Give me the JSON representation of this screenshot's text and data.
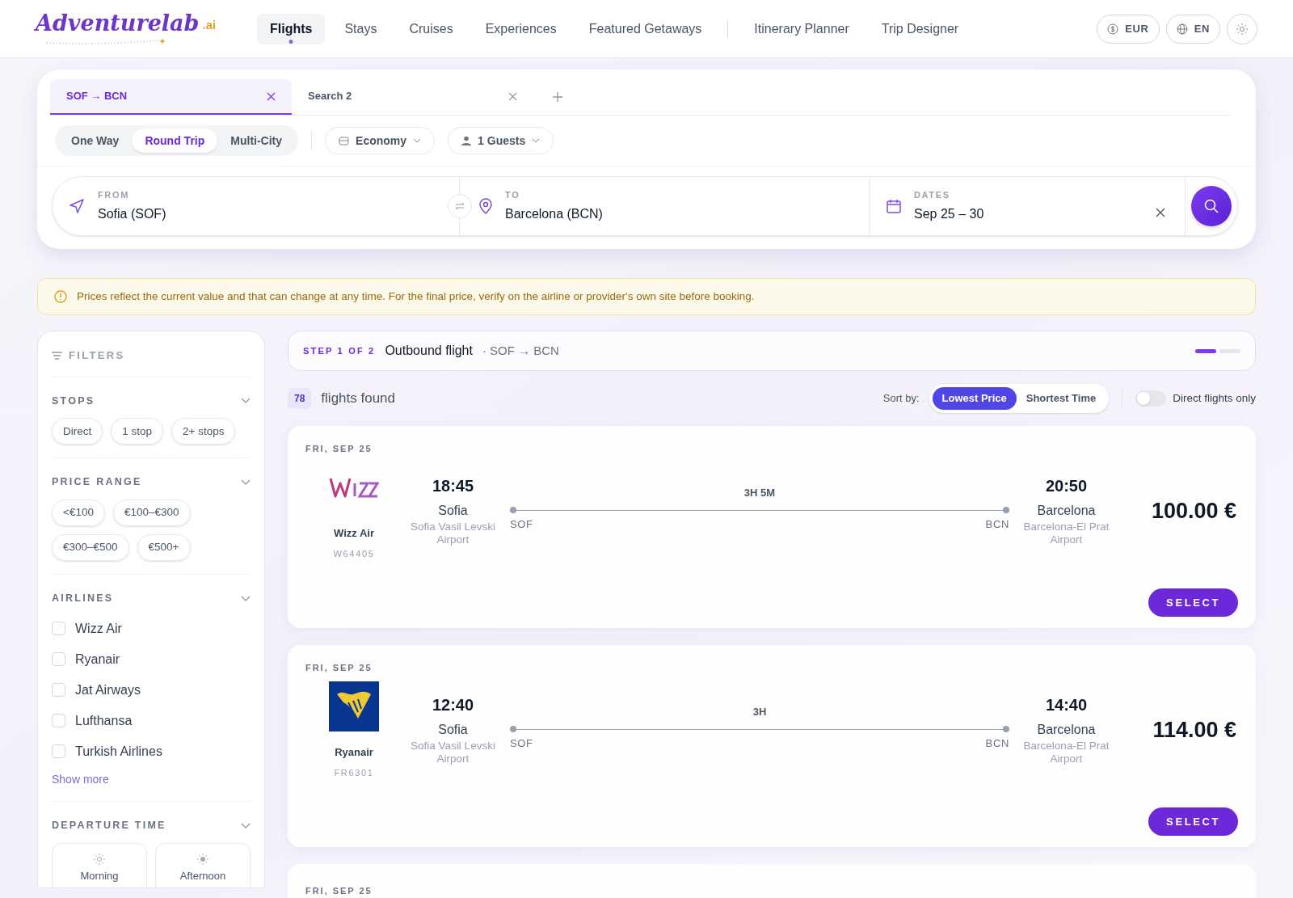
{
  "logo": {
    "name": "Adventurelab",
    "suffix": ".ai"
  },
  "nav_primary": [
    {
      "label": "Flights",
      "selected": true
    },
    {
      "label": "Stays",
      "selected": false
    },
    {
      "label": "Cruises",
      "selected": false
    },
    {
      "label": "Experiences",
      "selected": false
    },
    {
      "label": "Featured Getaways",
      "selected": false
    }
  ],
  "nav_secondary": [
    {
      "label": "Itinerary Planner",
      "selected": false
    },
    {
      "label": "Trip Designer",
      "selected": false
    }
  ],
  "header_controls": {
    "currency": "EUR",
    "language": "EN"
  },
  "search_tabs": [
    {
      "label": "SOF → BCN",
      "selected": true
    },
    {
      "label": "Search 2",
      "selected": false
    }
  ],
  "trip_types": [
    {
      "label": "One Way",
      "selected": false
    },
    {
      "label": "Round Trip",
      "selected": true
    },
    {
      "label": "Multi-City",
      "selected": false
    }
  ],
  "cabin": "Economy",
  "guests": "1 Guests",
  "fields": {
    "from": {
      "label": "FROM",
      "value": "Sofia (SOF)"
    },
    "to": {
      "label": "TO",
      "value": "Barcelona (BCN)"
    },
    "dates": {
      "label": "DATES",
      "value": "Sep 25 – 30"
    }
  },
  "notice": "Prices reflect the current value and that can change at any time. For the final price, verify on the airline or provider's own site before booking.",
  "filters": {
    "title": "FILTERS",
    "sections": [
      {
        "kind": "chips",
        "title": "STOPS",
        "options": [
          "Direct",
          "1 stop",
          "2+ stops"
        ]
      },
      {
        "kind": "chips",
        "title": "PRICE RANGE",
        "options": [
          "<€100",
          "€100–€300",
          "€300–€500",
          "€500+"
        ]
      },
      {
        "kind": "checkboxes",
        "title": "AIRLINES",
        "options": [
          {
            "label": "Wizz Air",
            "checked": false
          },
          {
            "label": "Ryanair",
            "checked": false
          },
          {
            "label": "Jat Airways",
            "checked": false
          },
          {
            "label": "Lufthansa",
            "checked": false
          },
          {
            "label": "Turkish Airlines",
            "checked": false
          }
        ],
        "more": "Show more"
      },
      {
        "kind": "tiles",
        "title": "DEPARTURE TIME",
        "options": [
          "Morning",
          "Afternoon"
        ]
      }
    ]
  },
  "step": {
    "label": "STEP 1 OF 2",
    "title": "Outbound flight",
    "route": "· SOF → BCN",
    "progress": [
      {
        "selected": true
      },
      {
        "selected": false
      }
    ]
  },
  "results": {
    "count": "78",
    "label": "flights found"
  },
  "sort": {
    "label": "Sort by:",
    "options": [
      {
        "label": "Lowest Price",
        "selected": true
      },
      {
        "label": "Shortest Time",
        "selected": false
      }
    ]
  },
  "direct_toggle": {
    "label": "Direct flights only",
    "on": false
  },
  "flights": [
    {
      "date": "FRI, SEP 25",
      "kind": "wizz",
      "airline": "Wizz Air",
      "number": "W64405",
      "depart": "18:45",
      "from_city": "Sofia",
      "from_airport": "Sofia Vasil Levski Airport",
      "duration": "3H 5M",
      "from_code": "SOF",
      "to_code": "BCN",
      "arrive": "20:50",
      "to_city": "Barcelona",
      "to_airport": "Barcelona-El Prat Airport",
      "price": "100.00 €",
      "action": "SELECT"
    },
    {
      "date": "FRI, SEP 25",
      "kind": "ryanair",
      "airline": "Ryanair",
      "number": "FR6301",
      "depart": "12:40",
      "from_city": "Sofia",
      "from_airport": "Sofia Vasil Levski Airport",
      "duration": "3H",
      "from_code": "SOF",
      "to_code": "BCN",
      "arrive": "14:40",
      "to_city": "Barcelona",
      "to_airport": "Barcelona-El Prat Airport",
      "price": "114.00 €",
      "action": "SELECT"
    }
  ],
  "partial_card": {
    "date": "FRI, SEP 25"
  }
}
